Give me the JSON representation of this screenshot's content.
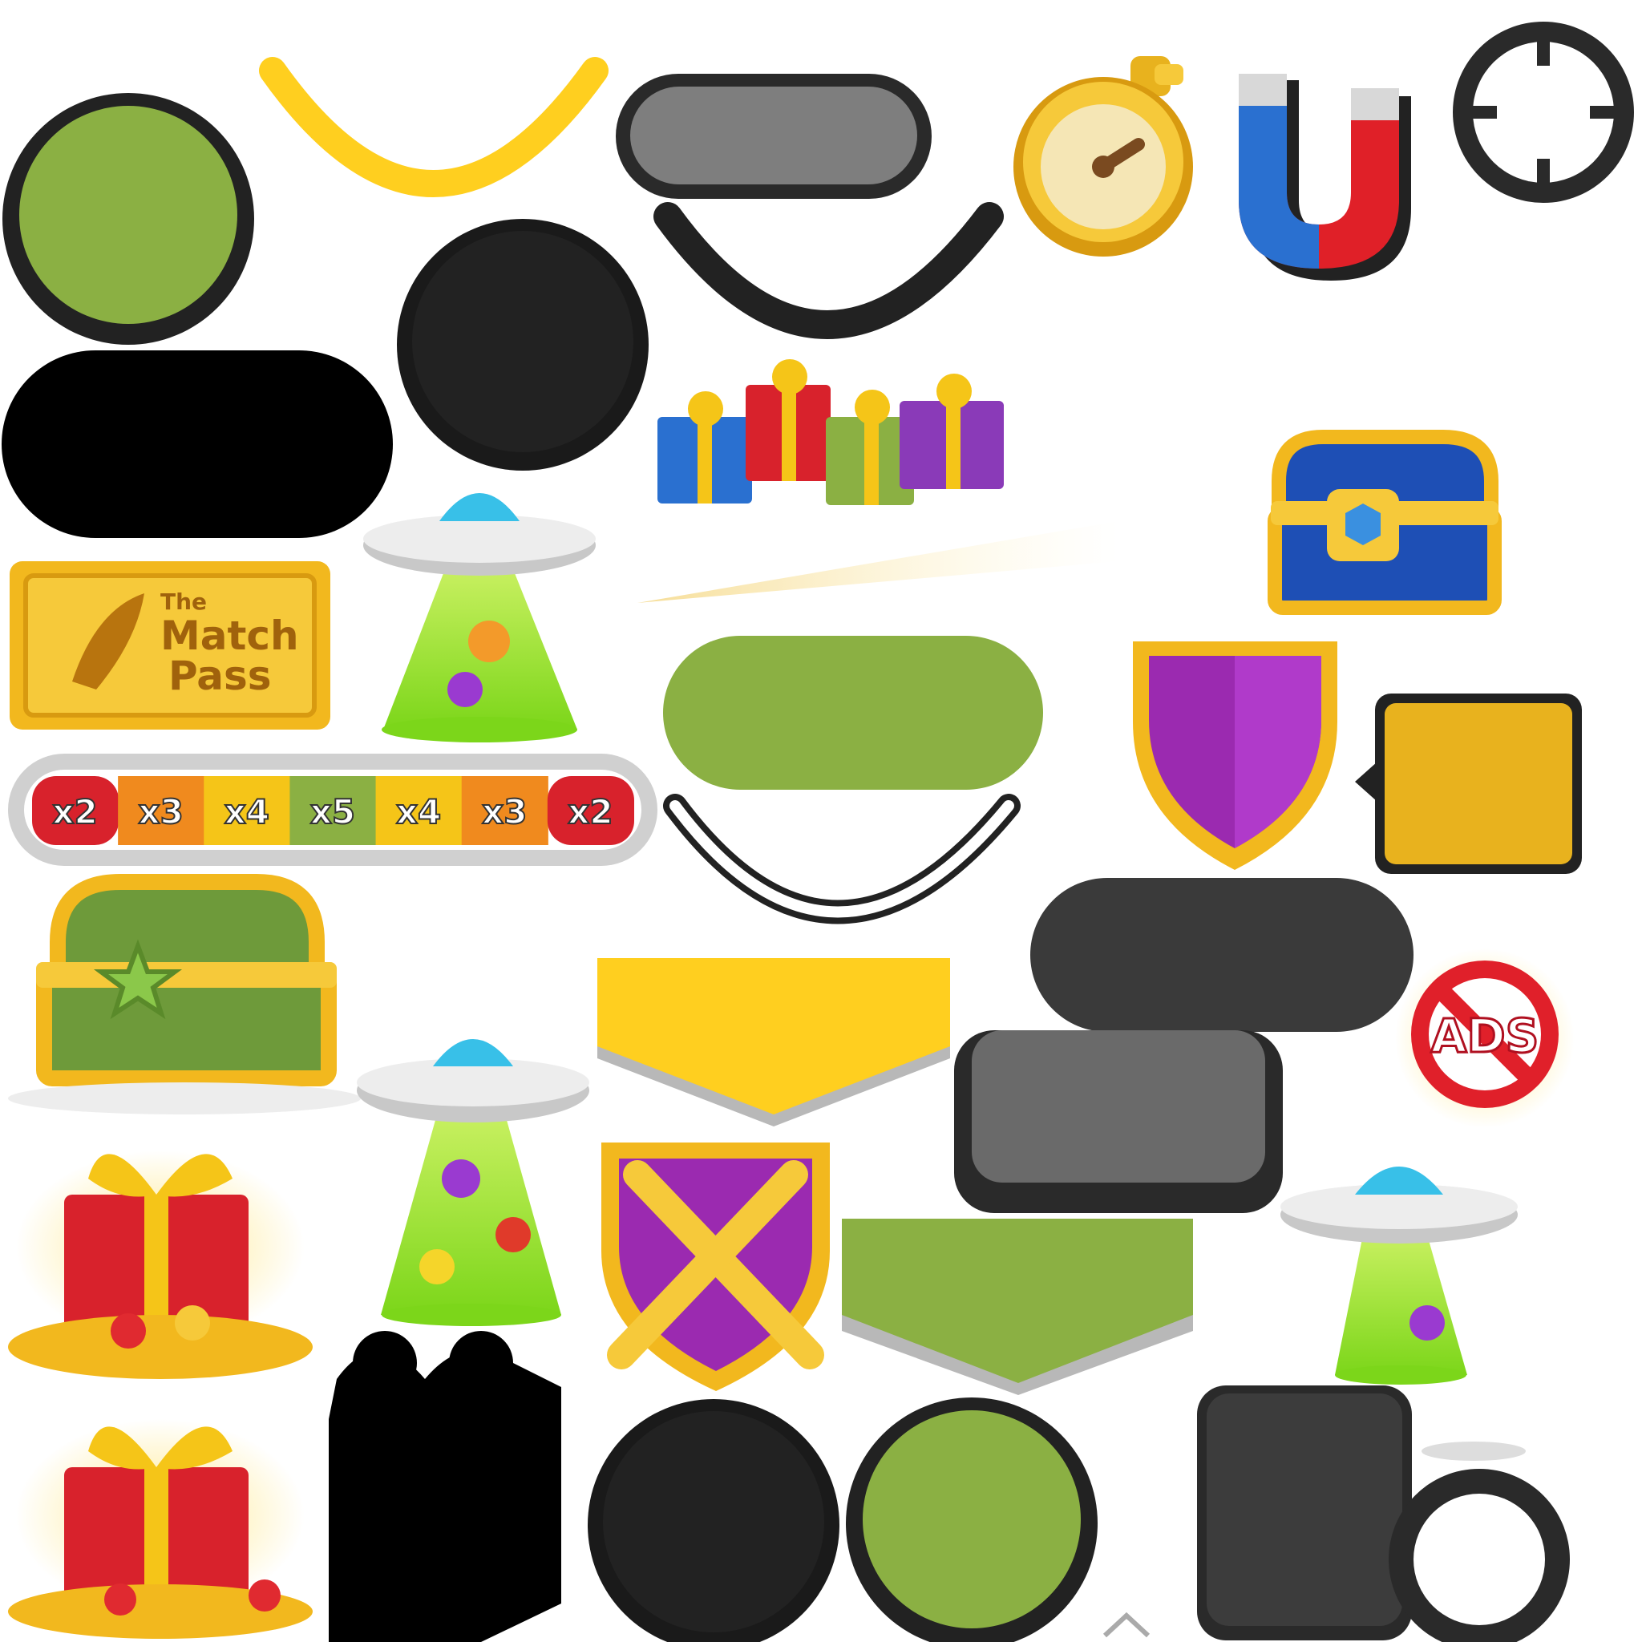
{
  "atlas": {
    "name": "game-ui-sprite-sheet",
    "colors": {
      "green": "#8BB043",
      "black": "#222222",
      "yellow": "#FFCF1F",
      "gold": "#E8B21E",
      "purple": "#9B2AB0",
      "red": "#D8222C",
      "blue": "#2060C8",
      "orange": "#F08A1E",
      "gray": "#7A7A7A",
      "dark_gray": "#3A3A3A"
    }
  },
  "match_pass": {
    "line1": "The",
    "line2": "Match",
    "line3": "Pass"
  },
  "multiplier_bar": {
    "segments": [
      {
        "label": "x2",
        "color": "#D8222C"
      },
      {
        "label": "x3",
        "color": "#F08A1E"
      },
      {
        "label": "x4",
        "color": "#F5C518"
      },
      {
        "label": "x5",
        "color": "#8BB043"
      },
      {
        "label": "x4",
        "color": "#F5C518"
      },
      {
        "label": "x3",
        "color": "#F08A1E"
      },
      {
        "label": "x2",
        "color": "#D8222C"
      }
    ]
  },
  "no_ads_badge": {
    "label": "ADS"
  },
  "icons": [
    "stopwatch-icon",
    "magnet-icon",
    "target-ring-icon",
    "gift-boxes-icon",
    "blue-chest-icon",
    "ufo-icon",
    "green-chest-icon",
    "purple-shield-icon",
    "crossed-swords-shield-icon",
    "gift-with-coins-icon",
    "gift-silhouette-icon",
    "speech-bubble-icon"
  ]
}
